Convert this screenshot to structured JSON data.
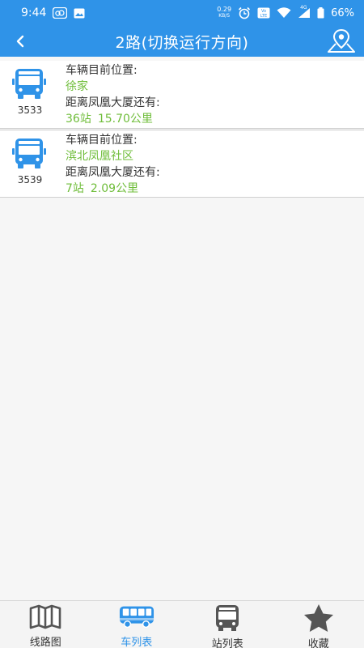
{
  "status_bar": {
    "time": "9:44",
    "net_speed_value": "0.29",
    "net_speed_unit": "KB/S",
    "volte_label": "Vo LTE",
    "network": "4G",
    "battery": "66%"
  },
  "toolbar": {
    "title": "2路(切换运行方向)",
    "back_icon": "chevron-left-icon",
    "map_icon": "map-pin-icon"
  },
  "vehicles": [
    {
      "bus_no": "3533",
      "position_label": "车辆目前位置:",
      "position": "徐家",
      "distance_label": "距离凤凰大厦还有:",
      "stops": "36站",
      "km": "15.70公里"
    },
    {
      "bus_no": "3539",
      "position_label": "车辆目前位置:",
      "position": "滨北凤凰社区",
      "distance_label": "距离凤凰大厦还有:",
      "stops": "7站",
      "km": "2.09公里"
    }
  ],
  "bottom_nav": {
    "tabs": [
      {
        "label": "线路图",
        "icon": "map-icon"
      },
      {
        "label": "车列表",
        "icon": "bus-icon"
      },
      {
        "label": "站列表",
        "icon": "bus-front-icon"
      },
      {
        "label": "收藏",
        "icon": "star-icon"
      }
    ],
    "active_index": 1
  },
  "colors": {
    "primary": "#2f93e8",
    "accent_green": "#6fbd3a",
    "bus_blue": "#2f93e8",
    "inactive_icon": "#555555"
  }
}
